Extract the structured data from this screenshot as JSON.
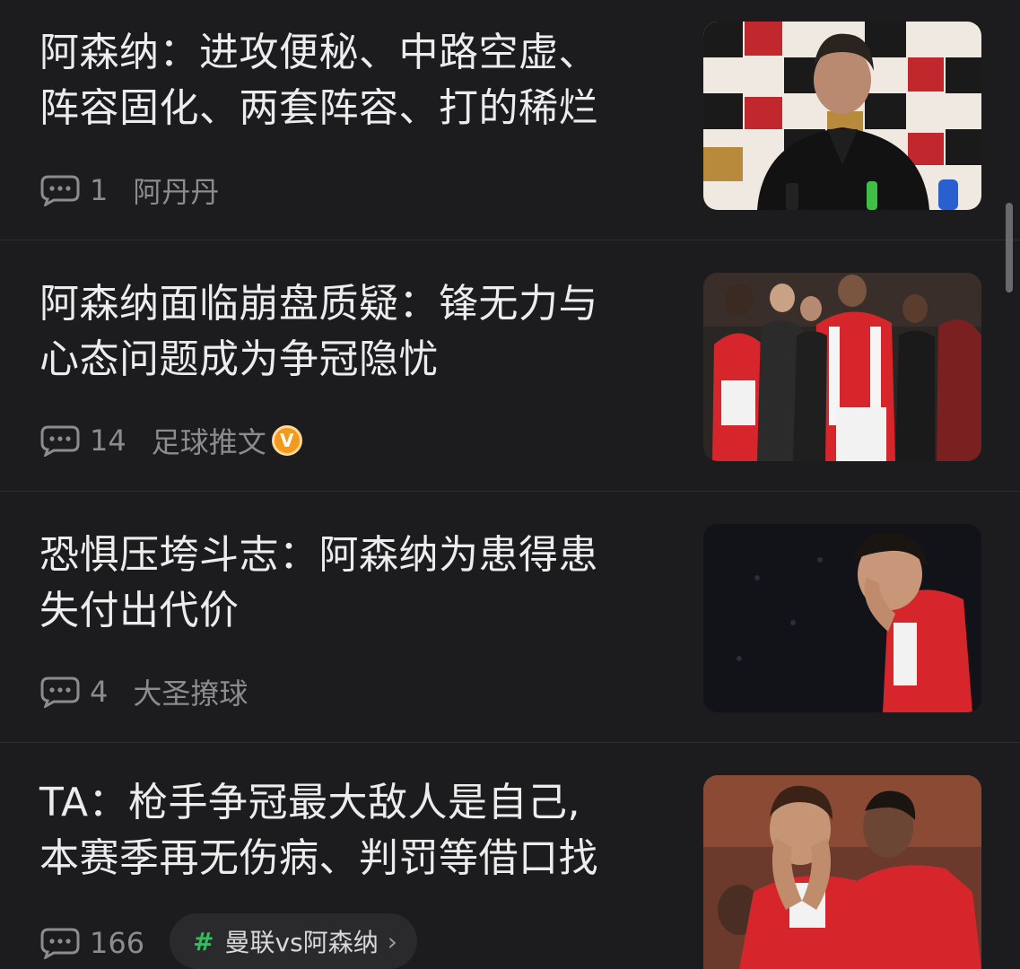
{
  "feed": {
    "items": [
      {
        "title_line1": "阿森纳：进攻便秘、中路空虚、",
        "title_line2": "阵容固化、两套阵容、打的稀烂",
        "comment_count": "1",
        "author": "阿丹丹",
        "thumbnail_icon": "press-conference-photo"
      },
      {
        "title_line1": "阿森纳面临崩盘质疑：锋无力与",
        "title_line2": "心态问题成为争冠隐忧",
        "comment_count": "14",
        "author": "足球推文",
        "verified_badge": "V",
        "thumbnail_icon": "players-on-pitch-photo"
      },
      {
        "title_line1": "恐惧压垮斗志：阿森纳为患得患",
        "title_line2": "失付出代价",
        "comment_count": "4",
        "author": "大圣撩球",
        "thumbnail_icon": "dejected-player-photo"
      },
      {
        "title_line1": "TA：枪手争冠最大敌人是自己,",
        "title_line2": "本赛季再无伤病、判罚等借口找",
        "comment_count": "166",
        "topic_hash": "#",
        "topic_label": "曼联vs阿森纳",
        "topic_chevron": "›",
        "thumbnail_icon": "players-despair-photo"
      }
    ]
  },
  "colors": {
    "background": "#1c1c1e",
    "title_text": "#ececec",
    "meta_text": "#8c8c8e",
    "topic_hash": "#2fbf5b",
    "verified_badge": "#f39a1c",
    "arsenal_red": "#d7262b"
  }
}
